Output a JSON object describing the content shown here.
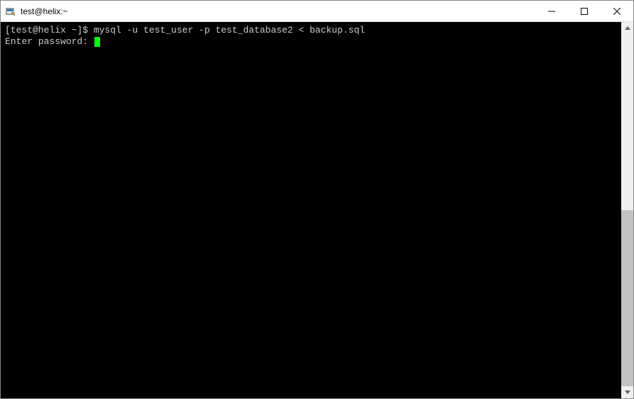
{
  "window": {
    "title": "test@helix:~"
  },
  "terminal": {
    "line1": {
      "prompt": "[test@helix ~]$ ",
      "command": "mysql -u test_user -p test_database2 < backup.sql"
    },
    "line2": {
      "label": "Enter password: "
    }
  }
}
